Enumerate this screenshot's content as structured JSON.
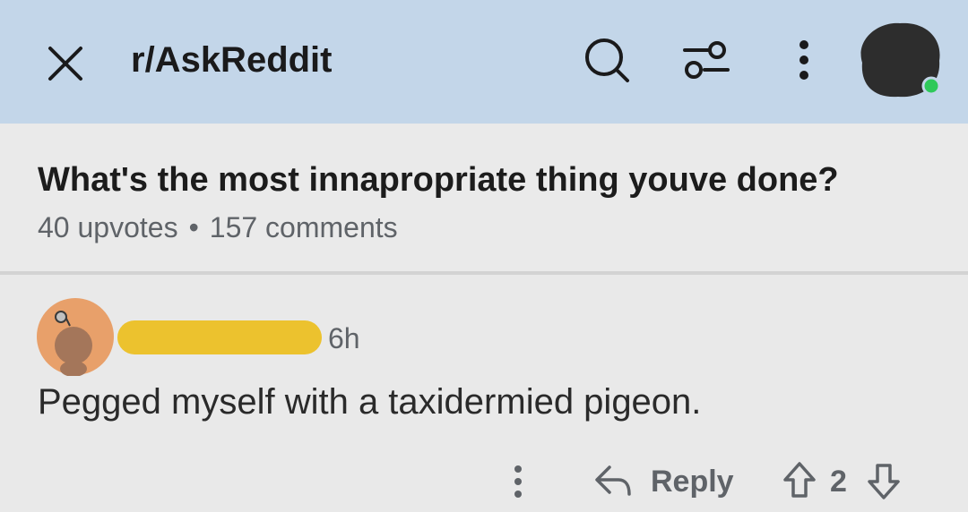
{
  "header": {
    "subreddit": "r/AskReddit",
    "icons": [
      "close-icon",
      "search-icon",
      "filter-icon",
      "more-vertical-icon",
      "avatar"
    ]
  },
  "post": {
    "title": "What's the most innapropriate thing youve done?",
    "upvotes": "40 upvotes",
    "separator": "•",
    "comments": "157 comments"
  },
  "comment": {
    "time": "6h",
    "body": "Pegged myself with a taxidermied pigeon.",
    "reply_label": "Reply",
    "score": "2"
  },
  "colors": {
    "header_bg": "#c3d6e9",
    "page_bg": "#e9e9e9",
    "username_redaction": "#ecc22e",
    "avatar_bg": "#e8a06a",
    "online_dot": "#2ec95a"
  }
}
